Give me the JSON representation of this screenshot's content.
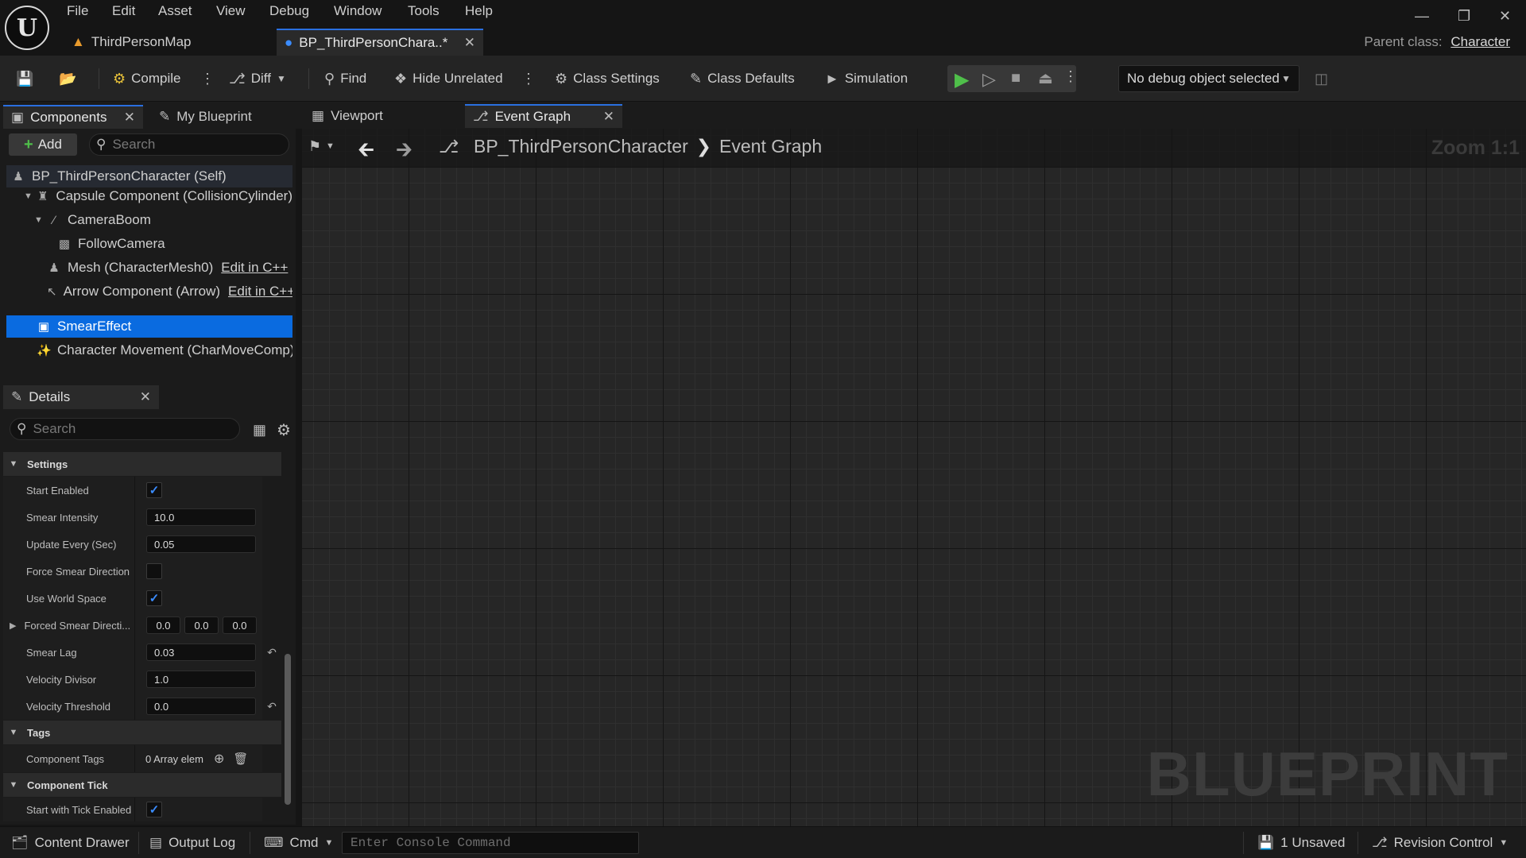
{
  "menu": [
    "File",
    "Edit",
    "Asset",
    "View",
    "Debug",
    "Window",
    "Tools",
    "Help"
  ],
  "doc_tabs": {
    "map": "ThirdPersonMap",
    "blueprint": "BP_ThirdPersonChara..*"
  },
  "parent_class": {
    "label": "Parent class:",
    "value": "Character"
  },
  "toolbar": {
    "compile": "Compile",
    "diff": "Diff",
    "find": "Find",
    "hide_unrelated": "Hide Unrelated",
    "class_settings": "Class Settings",
    "class_defaults": "Class Defaults",
    "simulation": "Simulation",
    "debug_object": "No debug object selected"
  },
  "components_panel": {
    "tab": "Components",
    "other_tab": "My Blueprint",
    "add": "Add",
    "search_placeholder": "Search",
    "tree": [
      {
        "label": "BP_ThirdPersonCharacter (Self)"
      },
      {
        "label": "Capsule Component (CollisionCylinder)"
      },
      {
        "label": "CameraBoom"
      },
      {
        "label": "FollowCamera"
      },
      {
        "label": "Mesh (CharacterMesh0)",
        "link": "Edit in C++"
      },
      {
        "label": "Arrow Component (Arrow)",
        "link": "Edit in C++"
      },
      {
        "label": "SmearEffect",
        "selected": true
      },
      {
        "label": "Character Movement (CharMoveComp)"
      }
    ]
  },
  "details_panel": {
    "tab": "Details",
    "search_placeholder": "Search",
    "categories": {
      "settings": "Settings",
      "tags": "Tags",
      "component_tick": "Component Tick"
    },
    "props": {
      "start_enabled": {
        "label": "Start Enabled",
        "checked": true
      },
      "smear_intensity": {
        "label": "Smear Intensity",
        "value": "10.0"
      },
      "update_every": {
        "label": "Update Every (Sec)",
        "value": "0.05"
      },
      "force_smear_direction": {
        "label": "Force Smear Direction",
        "checked": false
      },
      "use_world_space": {
        "label": "Use World Space",
        "checked": true
      },
      "forced_smear_direction": {
        "label": "Forced Smear Directi...",
        "x": "0.0",
        "y": "0.0",
        "z": "0.0"
      },
      "smear_lag": {
        "label": "Smear Lag",
        "value": "0.03"
      },
      "velocity_divisor": {
        "label": "Velocity Divisor",
        "value": "1.0"
      },
      "velocity_threshold": {
        "label": "Velocity Threshold",
        "value": "0.0"
      },
      "component_tags": {
        "label": "Component Tags",
        "value": "0 Array elem"
      },
      "start_with_tick": {
        "label": "Start with Tick Enabled",
        "checked": true
      }
    }
  },
  "graph": {
    "tabs": {
      "viewport": "Viewport",
      "event_graph": "Event Graph"
    },
    "breadcrumb": {
      "blueprint": "BP_ThirdPersonCharacter",
      "graph": "Event Graph"
    },
    "zoom": "Zoom 1:1",
    "watermark": "BLUEPRINT"
  },
  "statusbar": {
    "content_drawer": "Content Drawer",
    "output_log": "Output Log",
    "cmd": "Cmd",
    "console_placeholder": "Enter Console Command",
    "unsaved": "1 Unsaved",
    "revision_control": "Revision Control"
  },
  "colors": {
    "accent": "#0a6be0",
    "play": "#4fbf4a",
    "check": "#3b8cff"
  }
}
